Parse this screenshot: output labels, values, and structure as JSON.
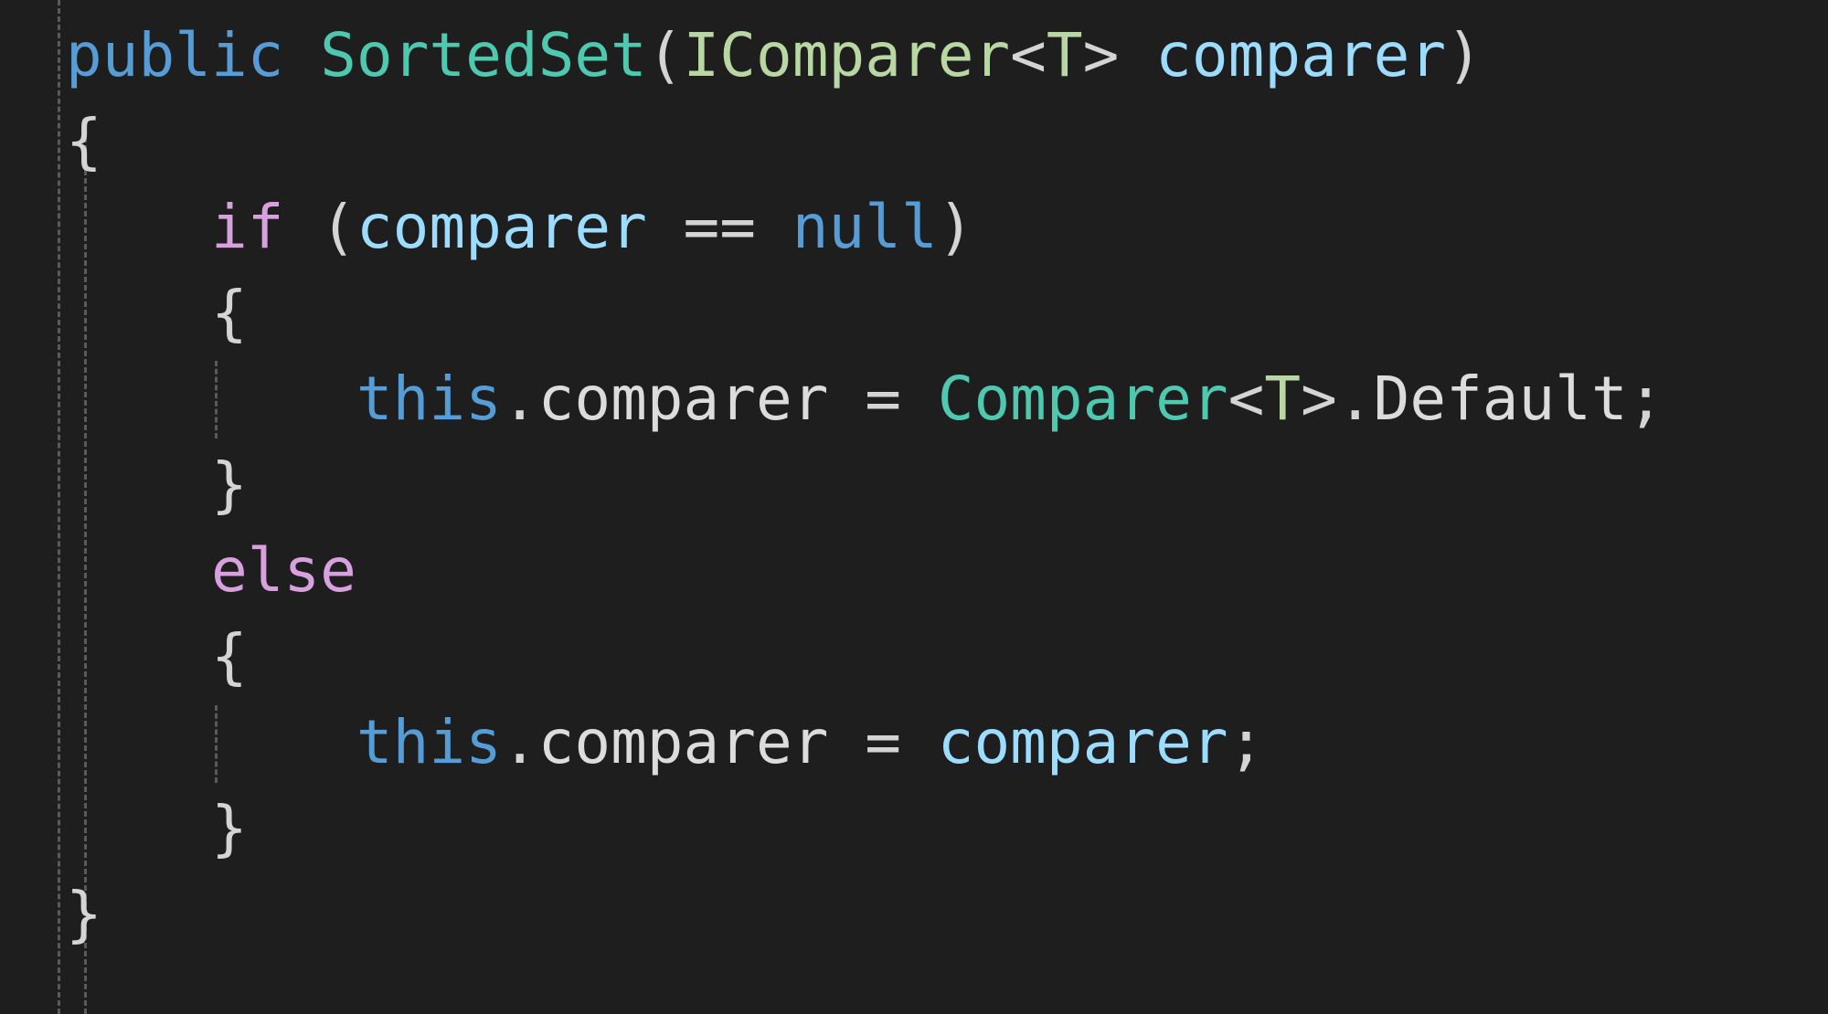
{
  "editor": {
    "background": "#1e1e1e",
    "colors": {
      "keyword": "#569cd6",
      "control_keyword": "#d8a0df",
      "type": "#4ec9b0",
      "interface": "#b8d7a3",
      "parameter": "#9cdcfe",
      "text": "#d4d4d4"
    },
    "lines": [
      {
        "tokens": [
          {
            "text": "public",
            "kind": "keyword"
          },
          {
            "text": " ",
            "kind": "punct"
          },
          {
            "text": "SortedSet",
            "kind": "type"
          },
          {
            "text": "(",
            "kind": "punct"
          },
          {
            "text": "IComparer",
            "kind": "interface"
          },
          {
            "text": "<",
            "kind": "punct"
          },
          {
            "text": "T",
            "kind": "interface"
          },
          {
            "text": ">",
            "kind": "punct"
          },
          {
            "text": " ",
            "kind": "punct"
          },
          {
            "text": "comparer",
            "kind": "param"
          },
          {
            "text": ")",
            "kind": "punct"
          }
        ]
      },
      {
        "tokens": [
          {
            "text": "{",
            "kind": "punct"
          }
        ]
      },
      {
        "tokens": [
          {
            "text": "    ",
            "kind": "punct"
          },
          {
            "text": "if",
            "kind": "control"
          },
          {
            "text": " (",
            "kind": "punct"
          },
          {
            "text": "comparer",
            "kind": "param"
          },
          {
            "text": " == ",
            "kind": "punct"
          },
          {
            "text": "null",
            "kind": "keyword"
          },
          {
            "text": ")",
            "kind": "punct"
          }
        ]
      },
      {
        "tokens": [
          {
            "text": "    ",
            "kind": "punct"
          },
          {
            "text": "{",
            "kind": "punct"
          }
        ]
      },
      {
        "tokens": [
          {
            "text": "        ",
            "kind": "punct"
          },
          {
            "text": "this",
            "kind": "keyword"
          },
          {
            "text": ".",
            "kind": "punct"
          },
          {
            "text": "comparer",
            "kind": "field"
          },
          {
            "text": " = ",
            "kind": "punct"
          },
          {
            "text": "Comparer",
            "kind": "type"
          },
          {
            "text": "<",
            "kind": "punct"
          },
          {
            "text": "T",
            "kind": "interface"
          },
          {
            "text": ">",
            "kind": "punct"
          },
          {
            "text": ".",
            "kind": "punct"
          },
          {
            "text": "Default",
            "kind": "field"
          },
          {
            "text": ";",
            "kind": "punct"
          }
        ]
      },
      {
        "tokens": [
          {
            "text": "    ",
            "kind": "punct"
          },
          {
            "text": "}",
            "kind": "punct"
          }
        ]
      },
      {
        "tokens": [
          {
            "text": "    ",
            "kind": "punct"
          },
          {
            "text": "else",
            "kind": "control"
          }
        ]
      },
      {
        "tokens": [
          {
            "text": "    ",
            "kind": "punct"
          },
          {
            "text": "{",
            "kind": "punct"
          }
        ]
      },
      {
        "tokens": [
          {
            "text": "        ",
            "kind": "punct"
          },
          {
            "text": "this",
            "kind": "keyword"
          },
          {
            "text": ".",
            "kind": "punct"
          },
          {
            "text": "comparer",
            "kind": "field"
          },
          {
            "text": " = ",
            "kind": "punct"
          },
          {
            "text": "comparer",
            "kind": "param"
          },
          {
            "text": ";",
            "kind": "punct"
          }
        ]
      },
      {
        "tokens": [
          {
            "text": "    ",
            "kind": "punct"
          },
          {
            "text": "}",
            "kind": "punct"
          }
        ]
      },
      {
        "tokens": [
          {
            "text": "}",
            "kind": "punct"
          }
        ]
      }
    ]
  }
}
